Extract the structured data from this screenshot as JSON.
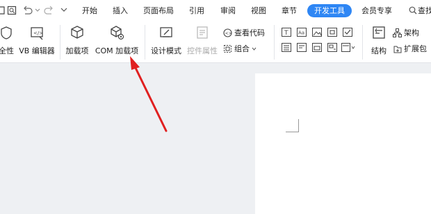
{
  "tabs": [
    "开始",
    "插入",
    "页面布局",
    "引用",
    "审阅",
    "视图",
    "章节",
    "开发工具",
    "会员专享"
  ],
  "search": {
    "label": "查找"
  },
  "ribbon": {
    "macro_security_label": "全性",
    "vb_editor_label": "VB 编辑器",
    "addins_label": "加载项",
    "com_addins_label": "COM 加载项",
    "design_mode_label": "设计模式",
    "control_props_label": "控件属性",
    "view_code_label": "查看代码",
    "group_label": "组合",
    "structure_label": "结构",
    "schema_label": "架构",
    "expansion_pack_label": "扩展包"
  },
  "colors": {
    "accent": "#2e86f4",
    "arrow": "#e02020"
  }
}
